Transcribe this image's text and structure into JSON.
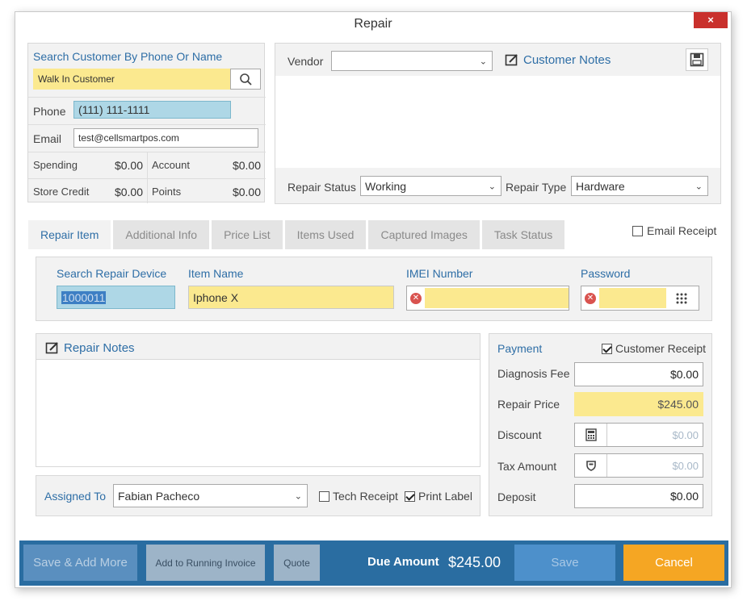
{
  "window": {
    "title": "Repair",
    "close_label": "×"
  },
  "customer": {
    "search_label": "Search Customer By Phone Or Name",
    "search_value": "Walk In Customer",
    "phone_label": "Phone",
    "phone_value": "(111) 111-1111",
    "email_label": "Email",
    "email_value": "test@cellsmartpos.com",
    "stats": [
      {
        "label": "Spending",
        "value": "$0.00"
      },
      {
        "label": "Account",
        "value": "$0.00"
      },
      {
        "label": "Store Credit",
        "value": "$0.00"
      },
      {
        "label": "Points",
        "value": "$0.00"
      }
    ]
  },
  "notes_panel": {
    "vendor_label": "Vendor",
    "vendor_value": "",
    "customer_notes_label": "Customer Notes",
    "repair_status_label": "Repair Status",
    "repair_status_value": "Working",
    "repair_type_label": "Repair Type",
    "repair_type_value": "Hardware"
  },
  "tabs": [
    {
      "label": "Repair Item",
      "active": true
    },
    {
      "label": "Additional Info",
      "active": false
    },
    {
      "label": "Price List",
      "active": false
    },
    {
      "label": "Items Used",
      "active": false
    },
    {
      "label": "Captured Images",
      "active": false
    },
    {
      "label": "Task Status",
      "active": false
    }
  ],
  "email_receipt": {
    "label": "Email Receipt",
    "checked": false
  },
  "repair_item": {
    "device_label": "Search Repair Device",
    "device_value": "1000011",
    "item_name_label": "Item Name",
    "item_name_value": "Iphone X",
    "imei_label": "IMEI Number",
    "imei_value": "",
    "password_label": "Password",
    "password_value": ""
  },
  "repair_notes": {
    "label": "Repair Notes"
  },
  "assign": {
    "label": "Assigned To",
    "value": "Fabian Pacheco",
    "tech_receipt_label": "Tech Receipt",
    "tech_receipt_checked": false,
    "print_label_label": "Print Label",
    "print_label_checked": true
  },
  "payment": {
    "title": "Payment",
    "customer_receipt_label": "Customer Receipt",
    "customer_receipt_checked": true,
    "rows": [
      {
        "label": "Diagnosis Fee",
        "value": "$0.00"
      },
      {
        "label": "Repair Price",
        "value": "$245.00"
      },
      {
        "label": "Discount",
        "value": "$0.00"
      },
      {
        "label": "Tax Amount",
        "value": "$0.00"
      },
      {
        "label": "Deposit",
        "value": "$0.00"
      }
    ]
  },
  "footer": {
    "save_add_more": "Save & Add More",
    "add_running_invoice": "Add to Running Invoice",
    "quote": "Quote",
    "due_amount_label": "Due Amount",
    "due_amount_value": "$245.00",
    "save": "Save",
    "cancel": "Cancel"
  },
  "icons": {
    "search": "search-icon",
    "notes": "edit-note-icon",
    "save_disk": "floppy-disk-icon",
    "error": "error-x-icon",
    "keypad": "keypad-icon",
    "calculator": "calculator-icon",
    "tax": "shield-icon"
  },
  "colors": {
    "accent_blue": "#2e6ea6",
    "footer_blue": "#2a6da1",
    "highlight_yellow": "#fbe98f",
    "cancel_orange": "#f5a623",
    "close_red": "#c9302c"
  }
}
